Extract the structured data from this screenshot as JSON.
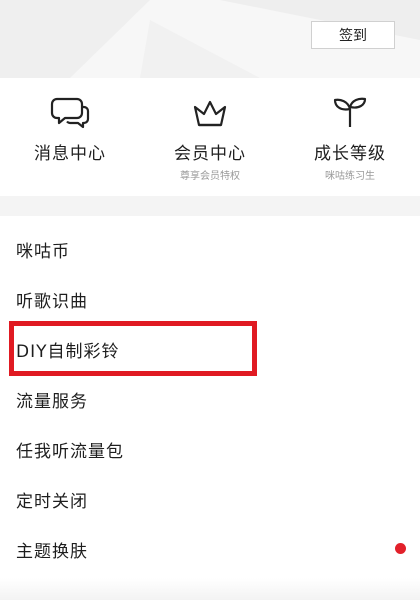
{
  "header": {
    "signin_label": "签到"
  },
  "shortcuts": [
    {
      "icon": "chat-bubbles-icon",
      "title": "消息中心",
      "subtitle": ""
    },
    {
      "icon": "crown-icon",
      "title": "会员中心",
      "subtitle": "尊享会员特权"
    },
    {
      "icon": "sprout-icon",
      "title": "成长等级",
      "subtitle": "咪咕练习生"
    }
  ],
  "menu": {
    "items": [
      {
        "label": "咪咕币"
      },
      {
        "label": "听歌识曲"
      },
      {
        "label": "DIY自制彩铃"
      },
      {
        "label": "流量服务"
      },
      {
        "label": "任我听流量包"
      },
      {
        "label": "定时关闭"
      },
      {
        "label": "主题换肤"
      }
    ]
  },
  "annotation": {
    "highlighted_item": "DIY自制彩铃",
    "color": "#e01a22"
  },
  "badge": {
    "color": "#e2202a"
  }
}
